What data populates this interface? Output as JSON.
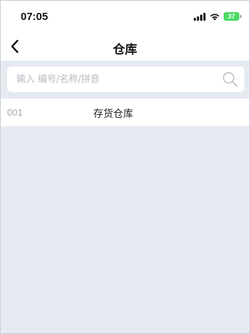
{
  "status_bar": {
    "time": "07:05",
    "battery": "37",
    "icons": [
      "signal-icon",
      "wifi-icon",
      "battery-charging-icon"
    ],
    "battery_color": "#4cd964"
  },
  "nav": {
    "title": "仓库",
    "back_icon": "chevron-left-icon"
  },
  "search": {
    "placeholder": "输入 编号/名称/拼音",
    "value": "",
    "icon": "search-icon"
  },
  "warehouses": [
    {
      "code": "001",
      "name": "存货仓库"
    }
  ],
  "colors": {
    "page_background": "#e5eaf1",
    "surface": "#ffffff",
    "muted_text": "#a4a8ae"
  }
}
